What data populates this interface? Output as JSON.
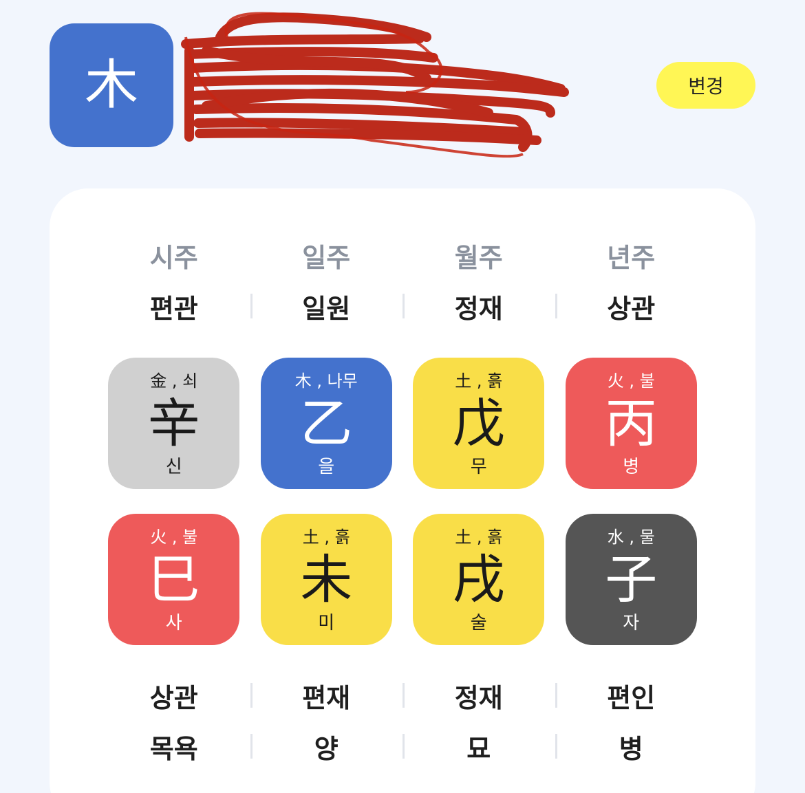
{
  "header": {
    "avatar_glyph": "木",
    "change_label": "변경"
  },
  "pillars": [
    "시주",
    "일주",
    "월주",
    "년주"
  ],
  "heaven_ten_gods": [
    "편관",
    "일원",
    "정재",
    "상관"
  ],
  "heaven_stems": [
    {
      "elem": "金 , 쇠",
      "glyph": "辛",
      "reading": "신",
      "color": "gray"
    },
    {
      "elem": "木 , 나무",
      "glyph": "乙",
      "reading": "을",
      "color": "blue"
    },
    {
      "elem": "土 , 흙",
      "glyph": "戊",
      "reading": "무",
      "color": "yellow"
    },
    {
      "elem": "火 , 불",
      "glyph": "丙",
      "reading": "병",
      "color": "red"
    }
  ],
  "earth_branches": [
    {
      "elem": "火 , 불",
      "glyph": "巳",
      "reading": "사",
      "color": "red"
    },
    {
      "elem": "土 , 흙",
      "glyph": "未",
      "reading": "미",
      "color": "yellow"
    },
    {
      "elem": "土 , 흙",
      "glyph": "戌",
      "reading": "술",
      "color": "yellow"
    },
    {
      "elem": "水 , 물",
      "glyph": "子",
      "reading": "자",
      "color": "dark"
    }
  ],
  "earth_ten_gods": [
    "상관",
    "편재",
    "정재",
    "편인"
  ],
  "twelve_stages": [
    "목욕",
    "양",
    "묘",
    "병"
  ],
  "colors": {
    "gray": "#d0d0d0",
    "blue": "#4472cd",
    "yellow": "#f9de48",
    "red": "#ee5a5a",
    "dark": "#555555",
    "button": "#fff655",
    "background": "#f2f6fd"
  }
}
